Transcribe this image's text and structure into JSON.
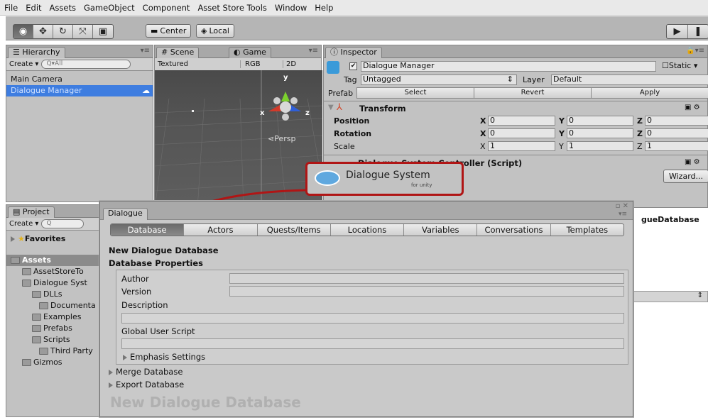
{
  "menu": [
    "File",
    "Edit",
    "Assets",
    "GameObject",
    "Component",
    "Asset Store Tools",
    "Window",
    "Help"
  ],
  "toolbar": {
    "pivot_label": "Center",
    "space_label": "Local"
  },
  "hierarchy": {
    "tab": "Hierarchy",
    "create": "Create",
    "search_placeholder": "Q▾All",
    "items": [
      "Main Camera",
      "Dialogue Manager"
    ]
  },
  "scene": {
    "tab_scene": "Scene",
    "tab_game": "Game",
    "shading": "Textured",
    "render_mode": "RGB",
    "mode_2d": "2D",
    "persp": "Persp",
    "axis_x": "x",
    "axis_y": "y",
    "axis_z": "z"
  },
  "inspector": {
    "tab": "Inspector",
    "object_name": "Dialogue Manager",
    "static_label": "Static",
    "tag_label": "Tag",
    "tag_value": "Untagged",
    "layer_label": "Layer",
    "layer_value": "Default",
    "prefab_label": "Prefab",
    "prefab_select": "Select",
    "prefab_revert": "Revert",
    "prefab_apply": "Apply",
    "transform_title": "Transform",
    "position_label": "Position",
    "rotation_label": "Rotation",
    "scale_label": "Scale",
    "position": {
      "x": "0",
      "y": "0",
      "z": "0"
    },
    "rotation": {
      "x": "0",
      "y": "0",
      "z": "0"
    },
    "scale": {
      "x": "1",
      "y": "1",
      "z": "1"
    },
    "script_title": "Dialogue System Controller (Script)",
    "logo_text": "Dialogue System",
    "logo_sub": "for unity",
    "wizard_label": "Wizard...",
    "db_field_fragment": "gueDatabase"
  },
  "project": {
    "tab": "Project",
    "create": "Create",
    "search_placeholder": "Q",
    "favorites": "Favorites",
    "assets": "Assets",
    "tree": [
      "AssetStoreTo",
      "Dialogue Syst",
      "DLLs",
      "Documenta",
      "Examples",
      "Prefabs",
      "Scripts",
      "Third Party",
      "Gizmos"
    ]
  },
  "dialog": {
    "tab": "Dialogue",
    "tabs": [
      "Database",
      "Actors",
      "Quests/Items",
      "Locations",
      "Variables",
      "Conversations",
      "Templates"
    ],
    "heading": "New Dialogue Database",
    "section": "Database Properties",
    "fields": [
      "Author",
      "Version",
      "Description",
      "Global User Script"
    ],
    "emphasis": "Emphasis Settings",
    "merge": "Merge Database",
    "export": "Export Database",
    "watermark": "New Dialogue Database"
  },
  "colors": {
    "selection": "#3e7de0",
    "callout": "#b01515",
    "panel": "#c2c2c2"
  }
}
